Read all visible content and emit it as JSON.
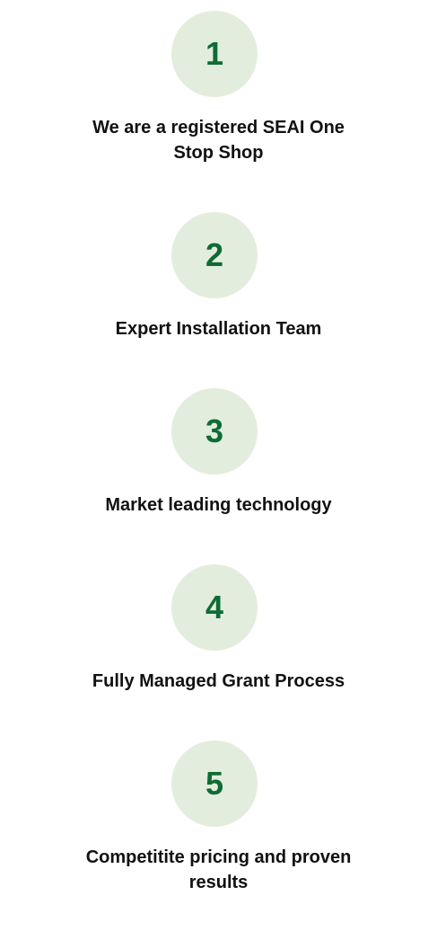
{
  "colors": {
    "circle_bg": "#e3eddd",
    "number": "#0f6b35",
    "text": "#111111",
    "background": "#ffffff"
  },
  "steps": [
    {
      "number": "1",
      "label": "We are a registered SEAI One Stop Shop"
    },
    {
      "number": "2",
      "label": "Expert Installation Team"
    },
    {
      "number": "3",
      "label": "Market leading technology"
    },
    {
      "number": "4",
      "label": "Fully Managed Grant Process"
    },
    {
      "number": "5",
      "label": "Competitite pricing and proven results"
    }
  ]
}
